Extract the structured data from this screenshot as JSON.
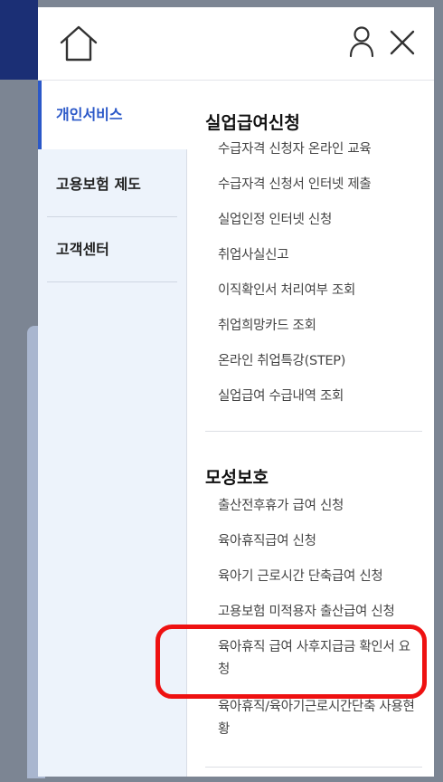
{
  "left_nav": {
    "items": [
      {
        "label": "개인서비스",
        "active": true
      },
      {
        "label": "고용보험 제도",
        "active": false
      },
      {
        "label": "고객센터",
        "active": false
      }
    ]
  },
  "sections": [
    {
      "title": "실업급여신청",
      "links": [
        "수급자격 신청자 온라인 교육",
        "수급자격 신청서 인터넷 제출",
        "실업인정 인터넷 신청",
        "취업사실신고",
        "이직확인서 처리여부 조회",
        "취업희망카드 조회",
        "온라인 취업특강(STEP)",
        "실업급여 수급내역 조회"
      ]
    },
    {
      "title": "모성보호",
      "links": [
        "출산전후휴가 급여 신청",
        "육아휴직급여 신청",
        "육아기 근로시간 단축급여 신청",
        "고용보험 미적용자 출산급여 신청",
        "육아휴직 급여 사후지급금 확인서 요청",
        "육아휴직/육아기근로시간단축 사용현황"
      ]
    }
  ],
  "colors": {
    "accent": "#2b58c8",
    "highlight": "#ee1111",
    "header_bg": "#1b2f75"
  },
  "icons": {
    "home": "home-icon",
    "user": "user-icon",
    "close": "close-icon"
  }
}
